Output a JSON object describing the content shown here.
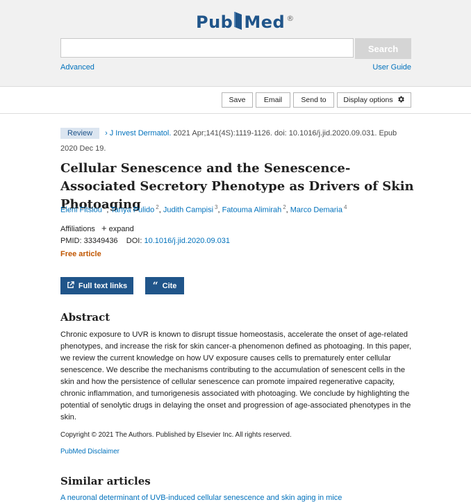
{
  "header": {
    "logo_text_left": "Pub",
    "logo_text_right": "Med",
    "logo_mark": "®",
    "search_placeholder": "",
    "search_button": "Search",
    "advanced_link": "Advanced",
    "user_guide_link": "User Guide"
  },
  "toolbar": {
    "save": "Save",
    "email": "Email",
    "send_to": "Send to",
    "display_options": "Display options",
    "display_icon": "gear-icon"
  },
  "article": {
    "badge": "Review",
    "journal": "J Invest Dermatol.",
    "citation": " 2021 Apr;141(4S):1119-1126. doi: 10.1016/j.jid.2020.09.031. Epub 2020 Dec 19.",
    "title": "Cellular Senescence and the Senescence-Associated Secretory Phenotype as Drivers of Skin Photoaging",
    "authors": [
      {
        "name": "Eleni Fitsiou",
        "aff": "1"
      },
      {
        "name": "Tanya Pulido",
        "aff": "2"
      },
      {
        "name": "Judith Campisi",
        "aff": "3"
      },
      {
        "name": "Fatouma Alimirah",
        "aff": "2"
      },
      {
        "name": "Marco Demaria",
        "aff": "4"
      }
    ],
    "affiliations_label": "Affiliations",
    "expand_label": "expand",
    "pmid_label": "PMID: 33349436",
    "doi_label": "DOI:",
    "doi_value": "10.1016/j.jid.2020.09.031",
    "free_article": "Free article",
    "full_text_button": "Full text links",
    "cite_button": "Cite"
  },
  "abstract": {
    "heading": "Abstract",
    "text": "Chronic exposure to UVR is known to disrupt tissue homeostasis, accelerate the onset of age-related phenotypes, and increase the risk for skin cancer-a phenomenon defined as photoaging. In this paper, we review the current knowledge on how UV exposure causes cells to prematurely enter cellular senescence. We describe the mechanisms contributing to the accumulation of senescent cells in the skin and how the persistence of cellular senescence can promote impaired regenerative capacity, chronic inflammation, and tumorigenesis associated with photoaging. We conclude by highlighting the potential of senolytic drugs in delaying the onset and progression of age-associated phenotypes in the skin.",
    "copyright": "Copyright © 2021 The Authors. Published by Elsevier Inc. All rights reserved.",
    "disclaimer": "PubMed Disclaimer"
  },
  "similar": {
    "heading": "Similar articles",
    "first_item": "A neuronal determinant of UVB-induced cellular senescence and skin aging in mice"
  },
  "colors": {
    "brand_blue": "#20558a",
    "link_blue": "#0071bc",
    "free_orange": "#c05600"
  }
}
